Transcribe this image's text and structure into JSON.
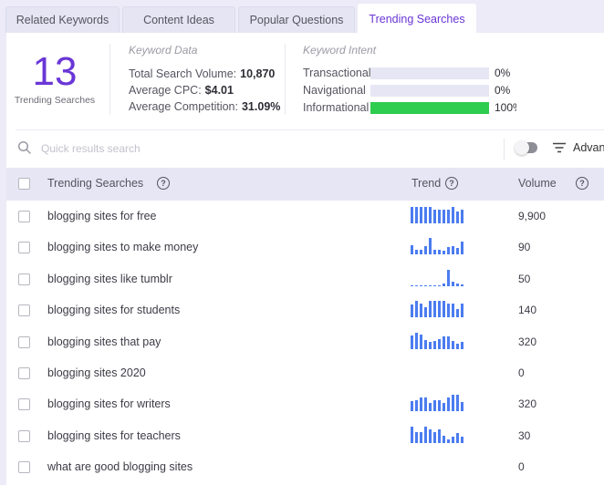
{
  "tabs": [
    {
      "label": "Related Keywords",
      "active": false
    },
    {
      "label": "Content Ideas",
      "active": false
    },
    {
      "label": "Popular Questions",
      "active": false
    },
    {
      "label": "Trending Searches",
      "active": true
    }
  ],
  "summary": {
    "count": "13",
    "count_label": "Trending Searches",
    "keyword_data": {
      "title": "Keyword Data",
      "items": [
        {
          "label": "Total Search Volume:",
          "value": "10,870"
        },
        {
          "label": "Average CPC:",
          "value": "$4.01"
        },
        {
          "label": "Average Competition:",
          "value": "31.09%"
        }
      ]
    },
    "keyword_intent": {
      "title": "Keyword Intent",
      "items": [
        {
          "label": "Transactional",
          "value": "0%",
          "fraction": 0
        },
        {
          "label": "Navigational",
          "value": "0%",
          "fraction": 0
        },
        {
          "label": "Informational",
          "value": "100%",
          "fraction": 1
        }
      ]
    }
  },
  "toolbar": {
    "search_placeholder": "Quick results search",
    "search_value": "",
    "toggle_on": false,
    "advanced_label": "Advanced"
  },
  "table": {
    "columns": {
      "keyword": "Trending Searches",
      "trend": "Trend",
      "volume": "Volume",
      "help_glyph": "?"
    },
    "rows": [
      {
        "keyword": "blogging sites for free",
        "volume": "9,900",
        "trend": [
          1,
          1,
          1,
          1,
          1,
          0.85,
          0.85,
          0.85,
          0.85,
          1,
          0.7,
          0.85
        ]
      },
      {
        "keyword": "blogging sites to make money",
        "volume": "90",
        "trend": [
          0.6,
          0.3,
          0.3,
          0.55,
          1,
          0.3,
          0.3,
          0.25,
          0.45,
          0.55,
          0.4,
          0.8
        ]
      },
      {
        "keyword": "blogging sites like tumblr",
        "volume": "50",
        "trend": [
          0.05,
          0.05,
          0.05,
          0.05,
          0.05,
          0.05,
          0.05,
          0.15,
          1,
          0.25,
          0.15,
          0.1
        ]
      },
      {
        "keyword": "blogging sites for students",
        "volume": "140",
        "trend": [
          0.8,
          1,
          0.85,
          0.6,
          1,
          1,
          1,
          1,
          0.85,
          0.85,
          0.5,
          0.85
        ]
      },
      {
        "keyword": "blogging sites that pay",
        "volume": "320",
        "trend": [
          0.8,
          1,
          0.85,
          0.55,
          0.4,
          0.5,
          0.6,
          0.75,
          0.75,
          0.5,
          0.3,
          0.4
        ]
      },
      {
        "keyword": "blogging sites 2020",
        "volume": "0",
        "trend": []
      },
      {
        "keyword": "blogging sites for writers",
        "volume": "320",
        "trend": [
          0.65,
          0.7,
          0.85,
          0.85,
          0.55,
          0.7,
          0.7,
          0.55,
          0.85,
          1,
          1,
          0.6
        ]
      },
      {
        "keyword": "blogging sites for teachers",
        "volume": "30",
        "trend": [
          1,
          0.65,
          0.65,
          1,
          0.85,
          0.65,
          0.85,
          0.45,
          0.2,
          0.4,
          0.6,
          0.4
        ]
      },
      {
        "keyword": "what are good blogging sites",
        "volume": "0",
        "trend": []
      }
    ]
  },
  "colors": {
    "accent": "#6a36d6",
    "trend_bar": "#4b7cf0",
    "intent_fill": "#2ecc4f",
    "intent_track": "#e6e6f4",
    "header_bg": "#e6e6f4"
  }
}
